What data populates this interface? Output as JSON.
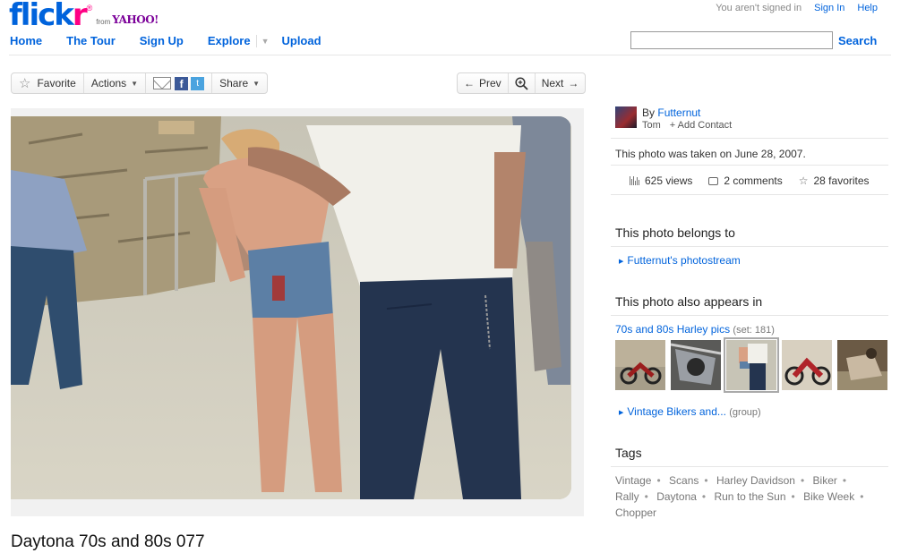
{
  "logo": {
    "brand": "flickr",
    "from": "from",
    "partner": "YAHOO!"
  },
  "account": {
    "status": "You aren't signed in",
    "sign_in": "Sign In",
    "help": "Help"
  },
  "nav": {
    "home": "Home",
    "tour": "The Tour",
    "signup": "Sign Up",
    "explore": "Explore",
    "upload": "Upload"
  },
  "search": {
    "button": "Search",
    "value": ""
  },
  "toolbar": {
    "favorite": "Favorite",
    "actions": "Actions",
    "share": "Share",
    "prev": "Prev",
    "next": "Next"
  },
  "photo": {
    "title": "Daytona 70s and 80s 077"
  },
  "owner": {
    "by": "By",
    "name": "Futternut",
    "real_name": "Tom",
    "add_contact": "+ Add Contact"
  },
  "meta": {
    "taken": "This photo was taken on June 28, 2007.",
    "views": "625 views",
    "comments": "2 comments",
    "favorites": "28 favorites"
  },
  "belongs": {
    "heading": "This photo belongs to",
    "photostream": "Futternut's photostream"
  },
  "appears": {
    "heading": "This photo also appears in",
    "set_name": "70s and 80s Harley pics",
    "set_count": "(set: 181)",
    "group_name": "Vintage Bikers and...",
    "group_label": "(group)"
  },
  "tags": {
    "heading": "Tags",
    "items": [
      "Vintage",
      "Scans",
      "Harley Davidson",
      "Biker",
      "Rally",
      "Daytona",
      "Run to the Sun",
      "Bike Week",
      "Chopper"
    ]
  },
  "colors": {
    "link": "#0063dc",
    "brand_pink": "#ff0084"
  }
}
